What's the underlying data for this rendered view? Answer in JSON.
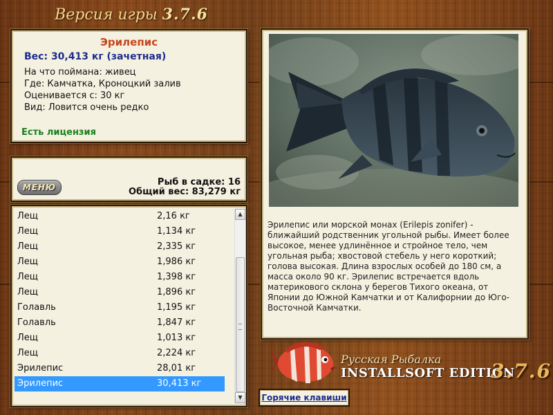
{
  "header": {
    "version_label": "Версия игры",
    "version_number": "3.7.6"
  },
  "fish_info": {
    "name": "Эрилепис",
    "weight": "Вес: 30,413 кг (зачетная)",
    "details": [
      "На что поймана: живец",
      "Где: Камчатка, Кроноцкий залив",
      "Оценивается с: 30 кг",
      "Вид: Ловится очень редко"
    ],
    "license": "Есть лицензия"
  },
  "menu": {
    "button_label": "МЕНЮ",
    "keep_count": "Рыб в садке: 16",
    "total_weight": "Общий вес: 83,279 кг"
  },
  "catch_list": {
    "items": [
      {
        "name": "Лещ",
        "weight": "2,16 кг"
      },
      {
        "name": "Лещ",
        "weight": "1,134 кг"
      },
      {
        "name": "Лещ",
        "weight": "2,335 кг"
      },
      {
        "name": "Лещ",
        "weight": "1,986 кг"
      },
      {
        "name": "Лещ",
        "weight": "1,398 кг"
      },
      {
        "name": "Лещ",
        "weight": "1,896 кг"
      },
      {
        "name": "Голавль",
        "weight": "1,195 кг"
      },
      {
        "name": "Голавль",
        "weight": "1,847 кг"
      },
      {
        "name": "Лещ",
        "weight": "1,013 кг"
      },
      {
        "name": "Лещ",
        "weight": "2,224 кг"
      },
      {
        "name": "Эрилепис",
        "weight": "28,01 кг"
      },
      {
        "name": "Эрилепис",
        "weight": "30,413 кг"
      }
    ],
    "selected_index": 11,
    "scroll_up_icon": "arrow-up-icon",
    "scroll_down_icon": "arrow-down-icon"
  },
  "description": "Эрилепис или морской монах (Erilepis zonifer) - ближайший родственник угольной рыбы. Имеет более высокое, менее удлинённое и стройное тело, чем угольная рыба; хвостовой стебель у него короткий; голова высокая. Длина взрослых особей до 180 см, а масса около 90 кг. Эрилепис встречается вдоль материкового склона у берегов Тихого океана, от Японии до Южной Камчатки и от Калифорнии до Юго-Восточной Камчатки.",
  "branding": {
    "title": "Русская Рыбалка",
    "edition": "INSTALLSOFT EDITION",
    "version": "3.7.6"
  },
  "hotkeys_label": "Горячие клавиши",
  "colors": {
    "fish_name": "#c8461b",
    "weight_text": "#1c2c8c",
    "license": "#18801c",
    "selection": "#3399ff",
    "panel_bg": "#f5f1e1"
  }
}
